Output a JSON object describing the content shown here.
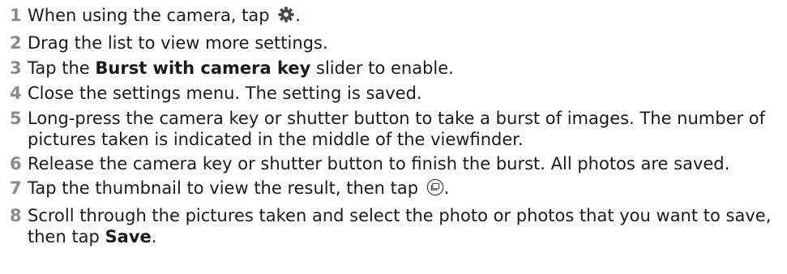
{
  "steps": [
    {
      "number": "1",
      "before": "When using the camera, tap ",
      "icon": "gear-icon",
      "after": "."
    },
    {
      "number": "2",
      "text": "Drag the list to view more settings."
    },
    {
      "number": "3",
      "before": "Tap the ",
      "bold": "Burst with camera key",
      "after": " slider to enable."
    },
    {
      "number": "4",
      "text": "Close the settings menu. The setting is saved."
    },
    {
      "number": "5",
      "text": "Long-press the camera key or shutter button to take a burst of images. The number of pictures taken is indicated in the middle of the viewfinder."
    },
    {
      "number": "6",
      "text": "Release the camera key or shutter button to finish the burst. All photos are saved."
    },
    {
      "number": "7",
      "before": "Tap the thumbnail to view the result, then tap ",
      "icon": "burst-gallery-icon",
      "after": "."
    },
    {
      "number": "8",
      "before": "Scroll through the pictures taken and select the photo or photos that you want to save, then tap ",
      "bold": "Save",
      "after": "."
    }
  ]
}
